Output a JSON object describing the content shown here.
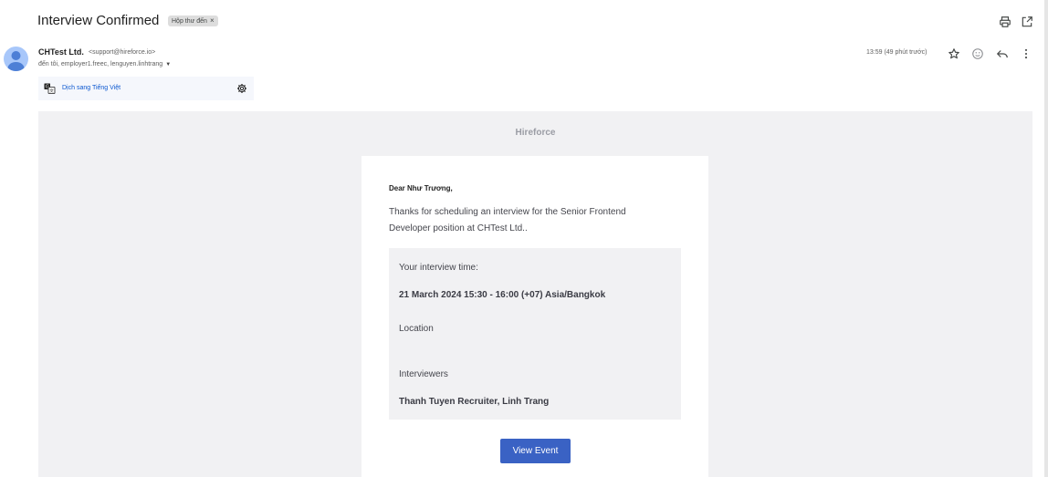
{
  "header": {
    "subject": "Interview Confirmed",
    "label_chip": "Hộp thư đến",
    "label_close": "×",
    "print_icon": "print-icon",
    "popout_icon": "open-in-new-window-icon"
  },
  "sender": {
    "avatar_icon": "person-avatar-icon",
    "name": "CHTest Ltd.",
    "email": "<support@hireforce.io>",
    "recipients": "đến tôi, employer1.freec, lenguyen.linhtrang",
    "recipients_caret": "▼",
    "time": "13:59 (49 phút trước)",
    "actions": [
      "star-icon",
      "emoji-icon",
      "reply-icon",
      "more-vert-icon"
    ]
  },
  "translate": {
    "icon": "translate-icon",
    "link": "Dịch sang Tiếng Việt",
    "settings_icon": "gear-icon"
  },
  "email": {
    "brand": "Hireforce",
    "greeting": "Dear Như Trương,",
    "intro": "Thanks for scheduling an interview for the Senior Frontend Developer position at CHTest Ltd..",
    "time_label": "Your interview time:",
    "time_value": "21 March 2024 15:30 - 16:00 (+07) Asia/Bangkok",
    "location_label": "Location",
    "interviewers_label": "Interviewers",
    "interviewers_value": "Thanh Tuyen Recruiter, Linh Trang",
    "button": "View Event"
  },
  "colors": {
    "accent_button": "#3a62c4",
    "link": "#0b57d0",
    "mail_background": "#f1f1f3",
    "avatar": "#a8c7fa"
  }
}
